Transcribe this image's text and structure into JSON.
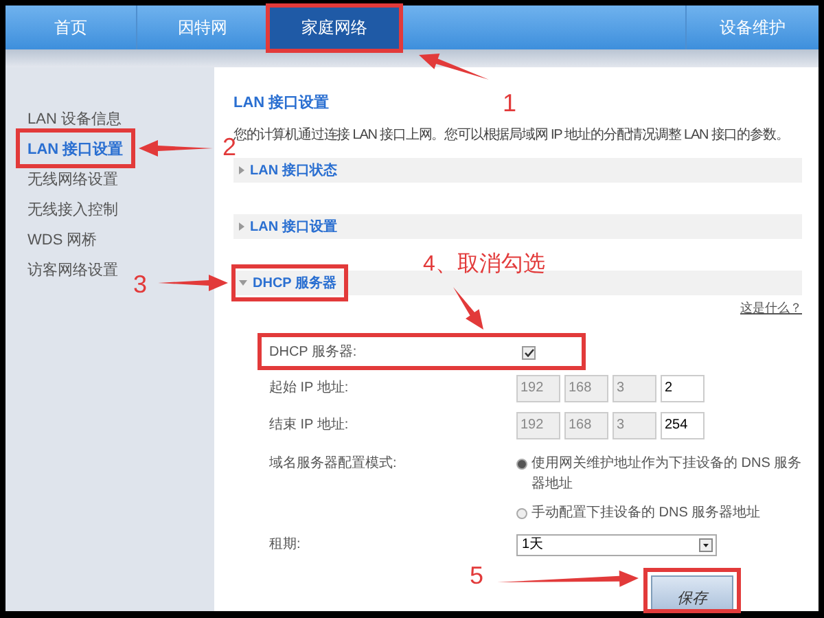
{
  "nav": [
    {
      "label": "首页",
      "selected": false
    },
    {
      "label": "因特网",
      "selected": false
    },
    {
      "label": "家庭网络",
      "selected": true
    },
    {
      "label": "设备维护",
      "selected": false
    }
  ],
  "sidebar": [
    {
      "label": "LAN 设备信息",
      "selected": false
    },
    {
      "label": "LAN 接口设置",
      "selected": true
    },
    {
      "label": "无线网络设置",
      "selected": false
    },
    {
      "label": "无线接入控制",
      "selected": false
    },
    {
      "label": "WDS 网桥",
      "selected": false
    },
    {
      "label": "访客网络设置",
      "selected": false
    }
  ],
  "page": {
    "title": "LAN 接口设置",
    "description": "您的计算机通过连接 LAN 接口上网。您可以根据局域网 IP 地址的分配情况调整 LAN 接口的参数。",
    "sections": [
      {
        "label": "LAN 接口状态",
        "expanded": false
      },
      {
        "label": "LAN 接口设置",
        "expanded": false
      },
      {
        "label": "DHCP 服务器",
        "expanded": true
      }
    ],
    "help_link": "这是什么？"
  },
  "form": {
    "dhcp": {
      "label": "DHCP 服务器:",
      "checked": true
    },
    "start_ip": {
      "label": "起始 IP 地址:",
      "fields": [
        {
          "value": "192",
          "disabled": true
        },
        {
          "value": "168",
          "disabled": true
        },
        {
          "value": "3",
          "disabled": true
        },
        {
          "value": "2",
          "disabled": false
        }
      ]
    },
    "end_ip": {
      "label": "结束 IP 地址:",
      "fields": [
        {
          "value": "192",
          "disabled": true
        },
        {
          "value": "168",
          "disabled": true
        },
        {
          "value": "3",
          "disabled": true
        },
        {
          "value": "254",
          "disabled": false
        }
      ]
    },
    "dns_mode": {
      "label": "域名服务器配置模式:",
      "options": [
        {
          "label": "使用网关维护地址作为下挂设备的 DNS 服务器地址",
          "selected": true
        },
        {
          "label": "手动配置下挂设备的 DNS 服务器地址",
          "selected": false
        }
      ]
    },
    "lease": {
      "label": "租期:",
      "value": "1天"
    },
    "save": "保存"
  },
  "annotations": [
    "1",
    "2",
    "3",
    "4、取消勾选",
    "5"
  ]
}
